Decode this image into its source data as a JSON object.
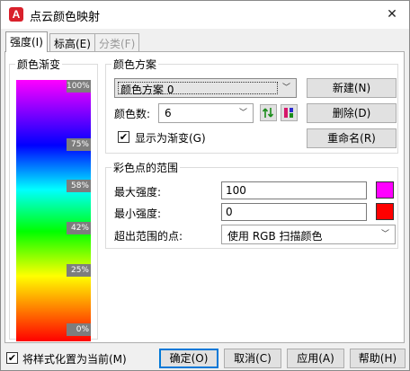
{
  "window": {
    "title": "点云颜色映射",
    "app_icon_letter": "A"
  },
  "tabs": [
    {
      "label": "强度(I)"
    },
    {
      "label": "标高(E)"
    },
    {
      "label": "分类(F)"
    }
  ],
  "gradient_panel": {
    "title": "颜色渐变",
    "labels": [
      "100%",
      "75%",
      "58%",
      "42%",
      "25%",
      "0%"
    ],
    "colors": [
      "#ff00ff",
      "#0000ff",
      "#00ffff",
      "#00ff00",
      "#ffff00",
      "#ff0000"
    ]
  },
  "scheme": {
    "title": "颜色方案",
    "selected": "颜色方案 0",
    "count_label": "颜色数:",
    "count_value": "6",
    "show_gradient_label": "显示为渐变(G)",
    "show_gradient_checked": true,
    "new_label": "新建(N)",
    "delete_label": "删除(D)",
    "rename_label": "重命名(R)"
  },
  "range": {
    "title": "彩色点的范围",
    "max_label": "最大强度:",
    "max_value": "100",
    "max_color": "#ff00ff",
    "min_label": "最小强度:",
    "min_value": "0",
    "min_color": "#ff0000",
    "out_label": "超出范围的点:",
    "out_value": "使用 RGB 扫描颜色"
  },
  "footer": {
    "set_current_label": "将样式化置为当前(M)",
    "set_current_checked": true,
    "ok": "确定(O)",
    "cancel": "取消(C)",
    "apply": "应用(A)",
    "help": "帮助(H)"
  }
}
